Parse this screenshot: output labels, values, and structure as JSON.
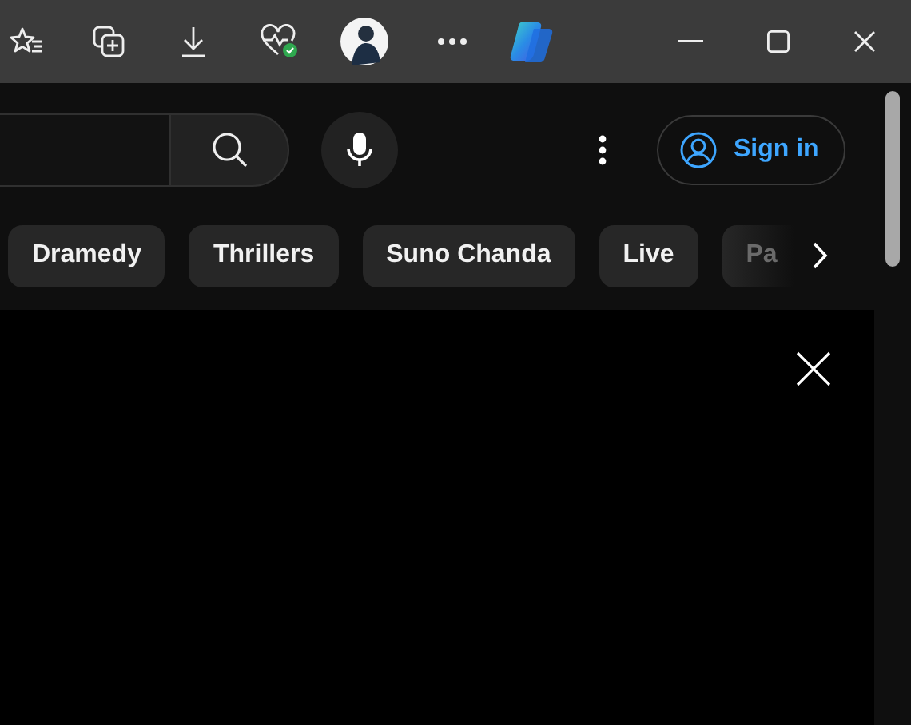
{
  "signin": {
    "label": "Sign in"
  },
  "chips": [
    {
      "label": "Dramedy"
    },
    {
      "label": "Thrillers"
    },
    {
      "label": "Suno Chanda"
    },
    {
      "label": "Live"
    },
    {
      "label": "Pa"
    }
  ]
}
